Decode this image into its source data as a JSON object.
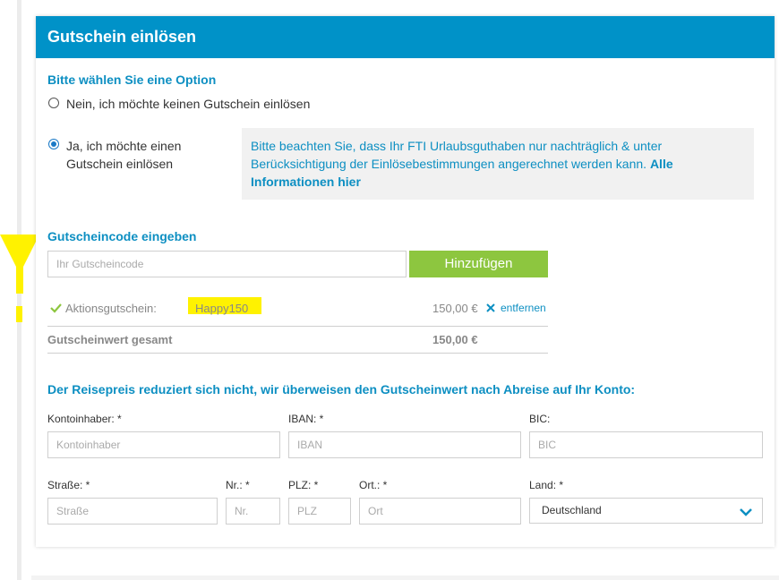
{
  "header": {
    "title": "Gutschein einlösen"
  },
  "options": {
    "title": "Bitte wählen Sie eine Option",
    "no_label": "Nein, ich möchte keinen Gutschein einlösen",
    "yes_label_line1": "Ja, ich möchte einen",
    "yes_label_line2": "Gutschein einlösen",
    "selected": "yes"
  },
  "info": {
    "text_line1": "Bitte beachten Sie, dass Ihr FTI Urlaubsguthaben nur nachträglich & unter",
    "text_line2": "Berücksichtigung der Einlösebestimmungen angerechnet werden kann.",
    "link_part1": "Alle",
    "link_part2": "Informationen hier"
  },
  "code": {
    "title": "Gutscheincode eingeben",
    "placeholder": "Ihr Gutscheincode",
    "add_button": "Hinzufügen"
  },
  "voucher": {
    "label": "Aktionsgutschein:",
    "code": "Happy150",
    "amount": "150,00 €",
    "remove_label": "entfernen"
  },
  "total": {
    "label": "Gutscheinwert gesamt",
    "amount": "150,00 €"
  },
  "refund": {
    "title": "Der Reisepreis reduziert sich nicht, wir überweisen den Gutscheinwert nach Abreise auf Ihr Konto:",
    "kontoinhaber_label": "Kontoinhaber: *",
    "kontoinhaber_placeholder": "Kontoinhaber",
    "iban_label": "IBAN: *",
    "iban_placeholder": "IBAN",
    "bic_label": "BIC:",
    "bic_placeholder": "BIC",
    "strasse_label": "Straße: *",
    "strasse_placeholder": "Straße",
    "nr_label": "Nr.: *",
    "nr_placeholder": "Nr.",
    "plz_label": "PLZ: *",
    "plz_placeholder": "PLZ",
    "ort_label": "Ort.: *",
    "ort_placeholder": "Ort",
    "land_label": "Land: *",
    "land_value": "Deutschland"
  },
  "colors": {
    "accent": "#0092c8",
    "title_text": "#0d8fc2",
    "button_green": "#8dc63f",
    "annotation_yellow": "#fff200"
  }
}
